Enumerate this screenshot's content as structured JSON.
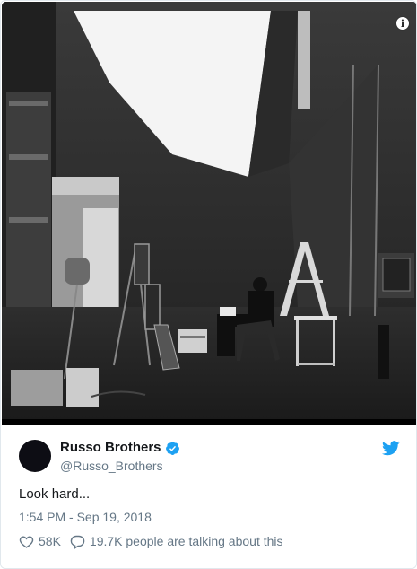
{
  "tweet": {
    "author": {
      "display_name": "Russo Brothers",
      "screen_name": "@Russo_Brothers",
      "verified": true,
      "avatar_color": "#0d0d14"
    },
    "text": "Look hard...",
    "timestamp": "1:54 PM - Sep 19, 2018",
    "likes": "58K",
    "conversation": "19.7K people are talking about this",
    "media": {
      "icon": "info-icon"
    }
  },
  "colors": {
    "twitter_blue": "#1da1f2",
    "secondary_text": "#657786",
    "primary_text": "#14171a"
  },
  "icons": {
    "verified": "verified-badge-icon",
    "brand": "twitter-bird-icon",
    "like": "heart-icon",
    "reply": "speech-bubble-icon"
  }
}
